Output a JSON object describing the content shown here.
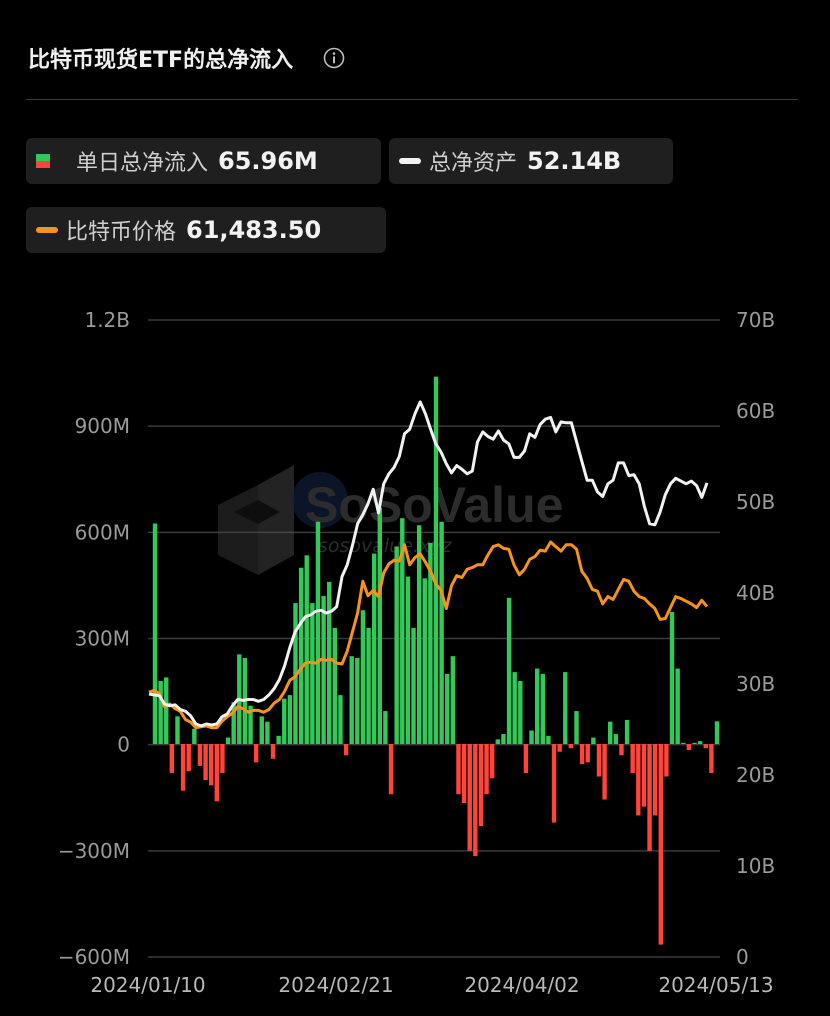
{
  "header": {
    "title": "比特币现货ETF的总净流入",
    "info_icon": "info-icon"
  },
  "legend": {
    "flow": {
      "label": "单日总净流入",
      "value": "65.96M"
    },
    "assets": {
      "label": "总净资产",
      "value": "52.14B"
    },
    "price": {
      "label": "比特币价格",
      "value": "61,483.50"
    }
  },
  "watermark": {
    "brand": "SoSoValue",
    "url": "sosovalue.xyz"
  },
  "colors": {
    "inflow": "#34c759",
    "outflow": "#ff453a",
    "assets_line": "#f2f2f2",
    "price_line": "#f7931a",
    "grid": "#3a3a3a",
    "background": "#000000"
  },
  "chart_data": {
    "type": "bar+line",
    "grid": true,
    "x_ticks": [
      "2024/01/10",
      "2024/02/21",
      "2024/04/02",
      "2024/05/13"
    ],
    "y_left": {
      "ticks": [
        "1.2B",
        "900M",
        "600M",
        "300M",
        "0",
        "−300M",
        "−600M"
      ],
      "range": [
        -600,
        1200
      ],
      "unit": "M"
    },
    "y_right": {
      "ticks": [
        "70B",
        "60B",
        "50B",
        "40B",
        "30B",
        "20B",
        "10B",
        "0"
      ],
      "range": [
        0,
        70
      ],
      "unit": "B"
    },
    "series": [
      {
        "name": "单日总净流入",
        "kind": "bar",
        "unit": "M",
        "values": [
          625,
          180,
          190,
          -80,
          80,
          -130,
          -75,
          45,
          -60,
          -100,
          -115,
          -160,
          -80,
          20,
          120,
          255,
          245,
          110,
          -50,
          80,
          65,
          -40,
          25,
          130,
          140,
          400,
          500,
          535,
          400,
          630,
          420,
          460,
          330,
          140,
          -30,
          250,
          245,
          380,
          330,
          540,
          670,
          95,
          -140,
          560,
          640,
          475,
          330,
          620,
          470,
          570,
          1040,
          630,
          200,
          250,
          -140,
          -165,
          -300,
          -315,
          -230,
          -140,
          -95,
          15,
          30,
          415,
          205,
          180,
          -80,
          40,
          215,
          200,
          25,
          -220,
          -20,
          205,
          -10,
          95,
          -55,
          -50,
          20,
          -90,
          -155,
          65,
          30,
          -30,
          70,
          -80,
          -200,
          -175,
          -300,
          -200,
          -565,
          -90,
          375,
          215,
          5,
          -15,
          5,
          10,
          -10,
          -80,
          66
        ]
      },
      {
        "name": "总净资产",
        "kind": "line",
        "axis": "right",
        "unit": "B",
        "values": [
          28.9,
          28.8,
          28.7,
          27.8,
          27.6,
          27.7,
          27.2,
          27.0,
          26.5,
          25.6,
          25.4,
          25.6,
          25.5,
          25.6,
          26.4,
          26.7,
          27.6,
          28.3,
          28.2,
          28.3,
          28.3,
          28.1,
          28.3,
          28.8,
          29.5,
          30.5,
          32.0,
          34.0,
          35.7,
          36.6,
          37.4,
          37.6,
          38.0,
          38.1,
          37.8,
          38.0,
          38.5,
          41.8,
          43.1,
          45.2,
          47.6,
          48.6,
          49.8,
          51.4,
          48.8,
          52.0,
          53.1,
          53.8,
          55.0,
          57.5,
          58.0,
          59.7,
          61.0,
          59.7,
          58.0,
          56.4,
          55.5,
          54.2,
          53.2,
          54.0,
          53.6,
          53.1,
          53.4,
          56.6,
          57.7,
          57.2,
          56.9,
          57.8,
          56.8,
          56.4,
          54.9,
          54.9,
          55.6,
          57.5,
          57.1,
          58.5,
          59.1,
          59.3,
          57.7,
          58.8,
          58.7,
          58.7,
          56.6,
          54.5,
          52.4,
          52.4,
          51.1,
          50.6,
          52.0,
          52.4,
          54.3,
          54.3,
          52.9,
          53.0,
          52.0,
          49.5,
          47.6,
          47.5,
          48.9,
          50.8,
          52.0,
          52.6,
          52.3,
          52.0,
          52.3,
          51.8,
          50.5,
          52.1
        ]
      },
      {
        "name": "比特币价格",
        "kind": "line",
        "axis": "right",
        "unit": "B-scaled",
        "values": [
          29.1,
          29.3,
          28.9,
          27.5,
          27.8,
          27.3,
          27.0,
          26.1,
          25.8,
          25.2,
          25.3,
          25.4,
          25.2,
          25.2,
          25.9,
          26.4,
          26.8,
          27.5,
          27.3,
          26.9,
          27.1,
          27.1,
          26.9,
          27.2,
          27.9,
          28.3,
          29.2,
          30.4,
          30.8,
          31.6,
          32.3,
          32.4,
          32.3,
          32.7,
          32.6,
          32.7,
          32.3,
          32.2,
          33.6,
          35.7,
          37.8,
          41.3,
          39.7,
          40.3,
          39.6,
          42.2,
          43.2,
          43.6,
          43.5,
          45.3,
          43.1,
          43.9,
          44.3,
          43.4,
          42.4,
          41.0,
          40.3,
          38.3,
          40.8,
          41.9,
          41.7,
          42.6,
          42.8,
          43.1,
          43.1,
          44.2,
          45.1,
          45.3,
          44.9,
          44.8,
          43.1,
          42.0,
          42.6,
          43.7,
          44.0,
          44.7,
          44.6,
          45.6,
          45.1,
          44.6,
          45.3,
          45.3,
          44.8,
          42.4,
          41.6,
          40.4,
          40.2,
          38.8,
          39.6,
          39.3,
          40.4,
          41.5,
          41.3,
          40.2,
          39.6,
          39.4,
          38.8,
          38.3,
          37.1,
          37.2,
          38.4,
          39.6,
          39.4,
          39.1,
          38.8,
          38.4,
          39.2,
          38.5
        ]
      }
    ]
  }
}
